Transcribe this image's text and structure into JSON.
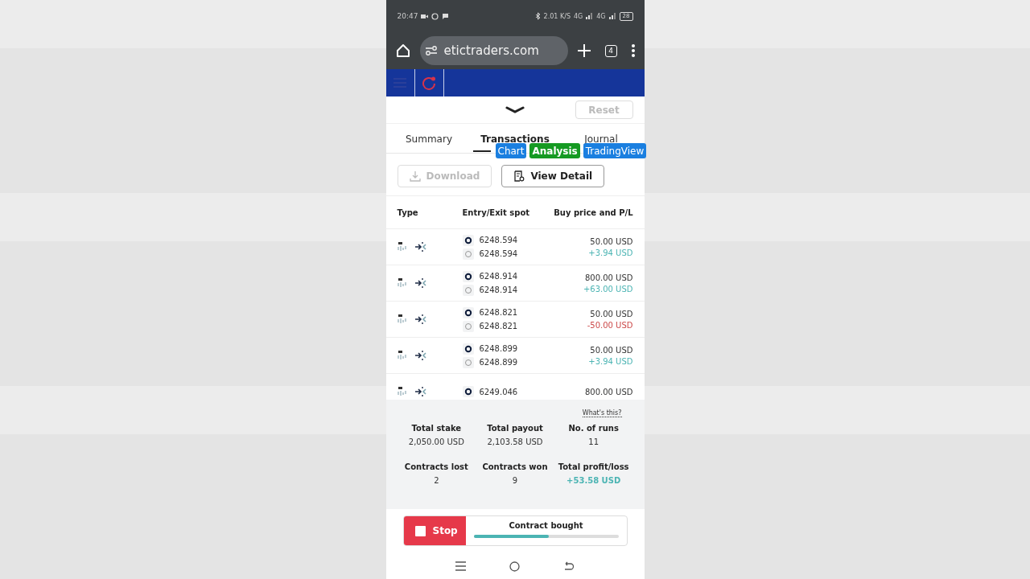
{
  "status_bar": {
    "time": "20:47",
    "net_speed": "2.01 K/S",
    "networks": [
      "4G",
      "4G"
    ],
    "battery": "28"
  },
  "browser": {
    "url": "etictraders.com",
    "tab_count": "4"
  },
  "panel": {
    "reset": {
      "label": "Reset",
      "disabled": true
    }
  },
  "tabs": [
    {
      "label": "Summary",
      "selected": false
    },
    {
      "label": "Transactions",
      "selected": true
    },
    {
      "label": "Journal",
      "selected": false
    }
  ],
  "overlay_buttons": [
    {
      "label": "Chart",
      "color": "#1a7fe0"
    },
    {
      "label": "Analysis",
      "color": "#159a22"
    },
    {
      "label": "TradingView",
      "color": "#1a7fe0"
    }
  ],
  "actions": [
    {
      "label": "Download",
      "disabled": true,
      "kind": "download"
    },
    {
      "label": "View Detail",
      "disabled": false,
      "kind": "detail"
    }
  ],
  "table": {
    "columns": [
      "Type",
      "Entry/Exit spot",
      "Buy price and P/L"
    ],
    "rows": [
      {
        "entry": "6248.594",
        "exit": "6248.594",
        "buy_price": "50.00 USD",
        "pl": "+3.94 USD",
        "won": true
      },
      {
        "entry": "6248.914",
        "exit": "6248.914",
        "buy_price": "800.00 USD",
        "pl": "+63.00 USD",
        "won": true
      },
      {
        "entry": "6248.821",
        "exit": "6248.821",
        "buy_price": "50.00 USD",
        "pl": "-50.00 USD",
        "won": false
      },
      {
        "entry": "6248.899",
        "exit": "6248.899",
        "buy_price": "50.00 USD",
        "pl": "+3.94 USD",
        "won": true
      },
      {
        "entry": "6249.046",
        "buy_price": "800.00 USD"
      }
    ]
  },
  "summary": {
    "link": "What's this?",
    "stats": [
      {
        "label": "Total stake",
        "value": "2,050.00 USD",
        "kind": "plain"
      },
      {
        "label": "Total payout",
        "value": "2,103.58 USD",
        "kind": "plain"
      },
      {
        "label": "No. of runs",
        "value": "11",
        "kind": "plain"
      },
      {
        "label": "Contracts lost",
        "value": "2",
        "kind": "plain"
      },
      {
        "label": "Contracts won",
        "value": "9",
        "kind": "plain"
      },
      {
        "label": "Total profit/loss",
        "value": "+53.58 USD",
        "kind": "profit"
      }
    ]
  },
  "run_bar": {
    "button": "Stop",
    "status": "Contract bought",
    "level": 0.52
  }
}
